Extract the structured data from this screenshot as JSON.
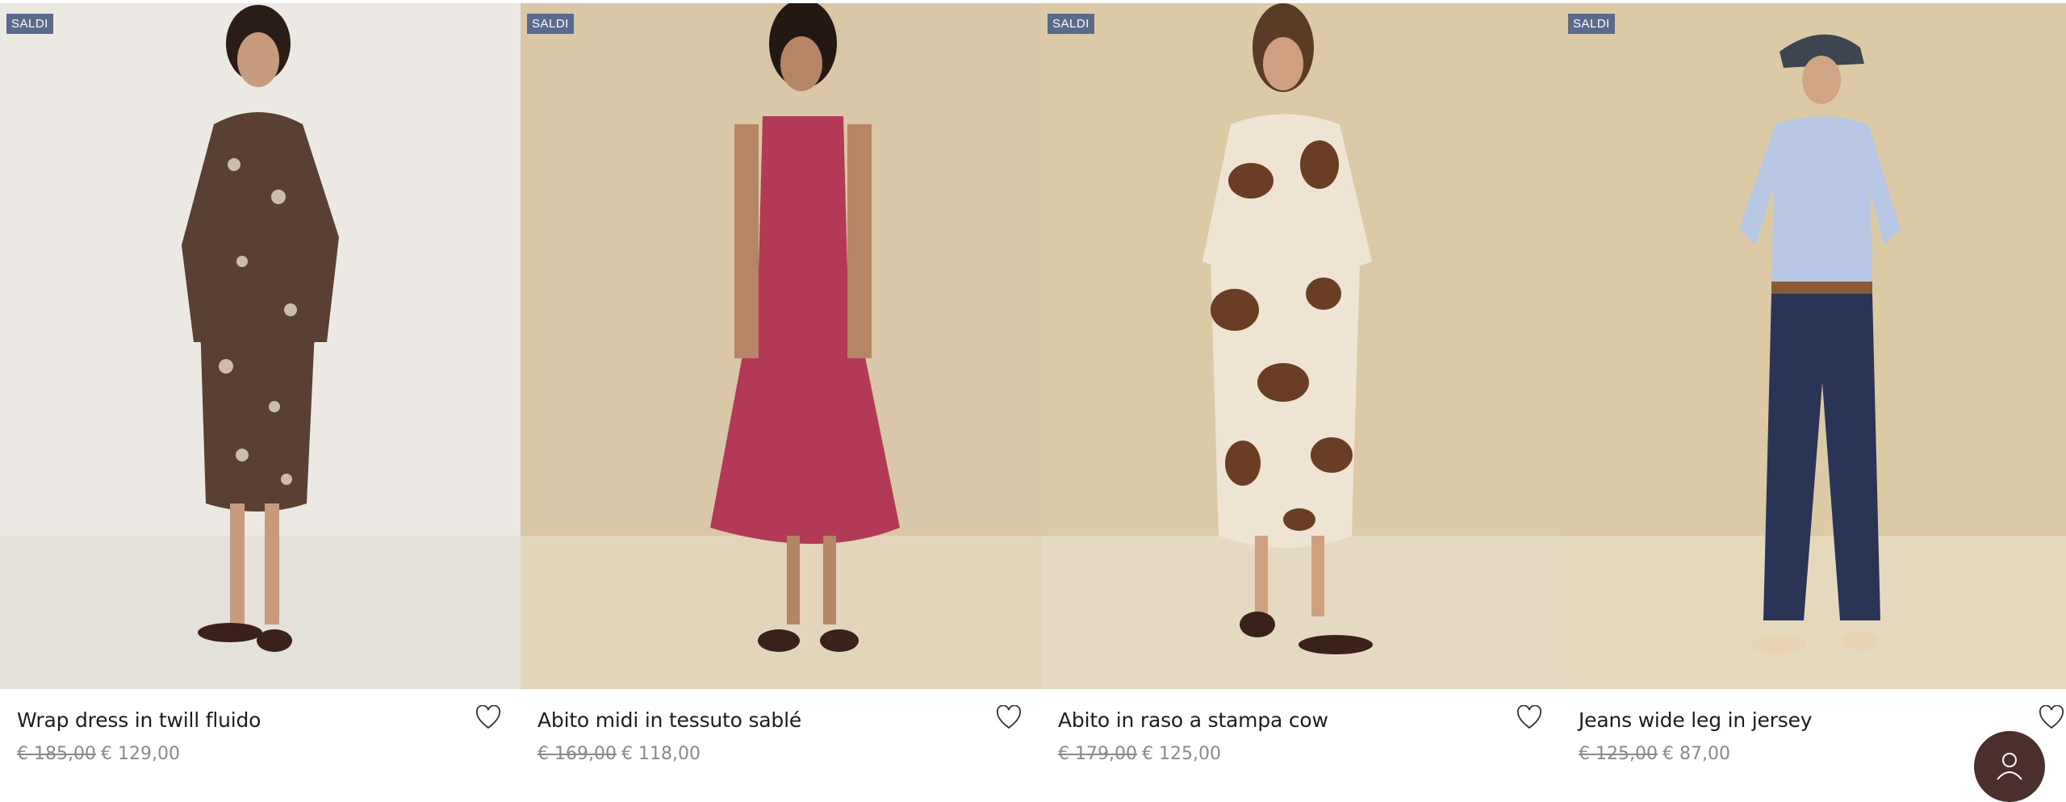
{
  "products": [
    {
      "badge": "SALDI",
      "title": "Wrap dress in twill fluido",
      "old_price": "€ 185,00",
      "new_price": "€ 129,00"
    },
    {
      "badge": "SALDI",
      "title": "Abito midi in tessuto sablé",
      "old_price": "€ 169,00",
      "new_price": "€ 118,00"
    },
    {
      "badge": "SALDI",
      "title": "Abito in raso a stampa cow",
      "old_price": "€ 179,00",
      "new_price": "€ 125,00"
    },
    {
      "badge": "SALDI",
      "title": "Jeans wide leg in jersey",
      "old_price": "€ 125,00",
      "new_price": "€ 87,00"
    }
  ],
  "colors": {
    "badge_bg": "#5a6a8c",
    "chat_button": "#4b2f2c",
    "price_text": "#8a8a8a",
    "title_text": "#1d1d1f"
  },
  "icons": {
    "wishlist": "heart-icon",
    "chat": "user-icon"
  }
}
